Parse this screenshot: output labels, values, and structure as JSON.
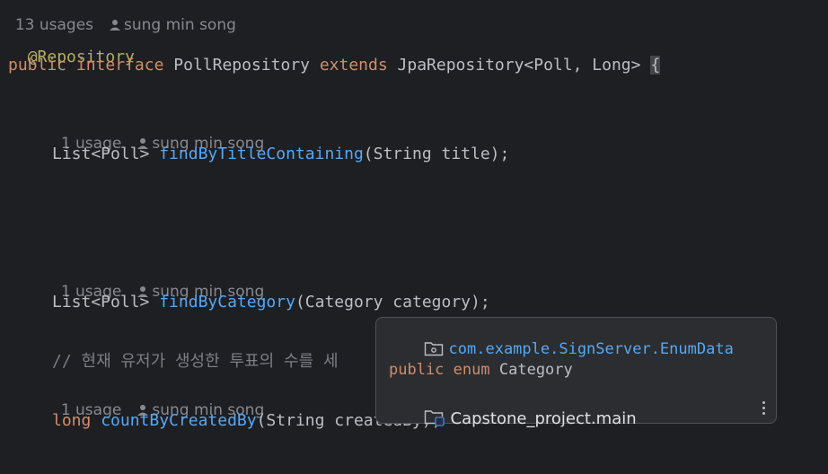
{
  "editor": {
    "top_hint": {
      "usages": "13 usages",
      "author": "sung min song"
    },
    "annotation": "@Repository",
    "decl": {
      "kw_public": "public",
      "kw_interface": "interface",
      "name": "PollRepository",
      "kw_extends": "extends",
      "parent": "JpaRepository<Poll, Long>",
      "brace": "{"
    },
    "method1": {
      "hint_usages": "1 usage",
      "hint_author": "sung min song",
      "return_type": "List<Poll>",
      "name": "findByTitleContaining",
      "params": "(String title);"
    },
    "method2": {
      "hint_usages": "1 usage",
      "hint_author": "sung min song",
      "return_type": "List<Poll>",
      "name": "findByCategory",
      "params": "(Category category);"
    },
    "comment": "// 현재 유저가 생성한 투표의 수를 세",
    "method3": {
      "hint_usages": "1 usage",
      "hint_author": "sung min song",
      "kw_long": "long",
      "name": "countByCreatedBy",
      "params": "(String createdBy);"
    }
  },
  "popup": {
    "package": "com.example.SignServer.EnumData",
    "kw_public": "public",
    "kw_enum": "enum",
    "type_name": "Category",
    "module": "Capstone_project.main",
    "icons": [
      "package-icon",
      "module-folder-icon",
      "more-options-icon"
    ]
  },
  "colors": {
    "background": "#1e1f22",
    "keyword": "#cf8e6d",
    "annotation": "#b3ae60",
    "function": "#56a8f5",
    "text": "#bcbec4",
    "hint": "#868991",
    "popup_bg": "#2b2d30"
  }
}
